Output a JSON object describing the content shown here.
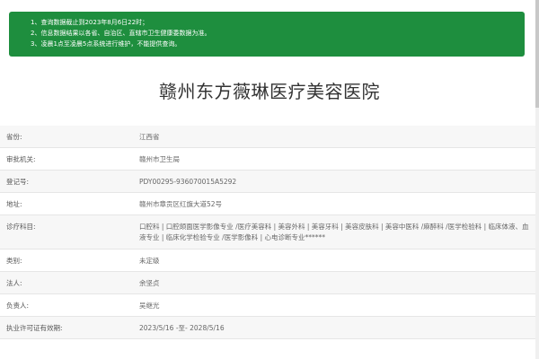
{
  "notice": {
    "lines": [
      "1、查询数据截止到2023年8月6日22时；",
      "2、信息数据结果以各省、自治区、直辖市卫生健康委数据为准。",
      "3、凌晨1点至凌晨5点系统进行维护，不能提供查询。"
    ],
    "background_color": "#1e8e3e"
  },
  "hospital": {
    "name": "赣州东方薇琳医疗美容医院"
  },
  "details": {
    "province": {
      "label": "省份:",
      "value": "江西省"
    },
    "authority": {
      "label": "审批机关:",
      "value": "赣州市卫生局"
    },
    "registration": {
      "label": "登记号:",
      "value": "PDY00295-936070015A5292"
    },
    "address": {
      "label": "地址:",
      "value": "赣州市章贡区红旗大道52号"
    },
    "departments": {
      "label": "诊疗科目:",
      "value": "口腔科 | 口腔颌面医学影像专业 /医疗美容科 | 美容外科 | 美容牙科 | 美容皮肤科 | 美容中医科 /麻醉科 /医学检验科 | 临床体液、血液专业 | 临床化学检验专业 /医学影像科 | 心电诊断专业******"
    },
    "category": {
      "label": "类别:",
      "value": "未定级"
    },
    "legal_person": {
      "label": "法人:",
      "value": "余坚贞"
    },
    "person_in_charge": {
      "label": "负责人:",
      "value": "吴继光"
    },
    "license_validity": {
      "label": "执业许可证有效期:",
      "value": "2023/5/16 -至- 2028/5/16"
    }
  }
}
